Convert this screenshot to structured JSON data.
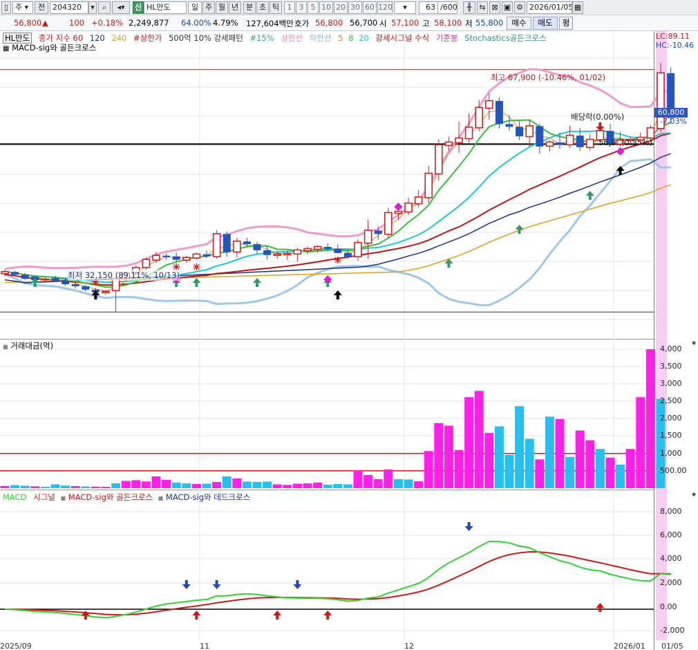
{
  "toolbar": {
    "type_select": "주",
    "prev_label": "전",
    "code_value": "204320",
    "badge": "신",
    "stock_name": "HL만도",
    "periods": [
      "일",
      "주",
      "월",
      "년",
      "분",
      "초",
      "틱"
    ],
    "active_period": "일",
    "intervals": [
      "1",
      "3",
      "5",
      "10",
      "20",
      "30",
      "60",
      "120"
    ],
    "page_count": "63",
    "page_total": "/600",
    "date_value": "2026/01/05"
  },
  "quote": {
    "price": "56,800",
    "change_arrow": "▲",
    "change": "100",
    "change_pct": "+0.18%",
    "volume": "2,249,877",
    "ratio1": "64.00%",
    "ratio2": "4.79%",
    "amount": "127,604백만",
    "ask_label": "호가",
    "ask1": "56,800",
    "ask2": "56,700",
    "open_label": "시",
    "open": "57,100",
    "high_label": "고",
    "high": "58,100",
    "low_label": "저",
    "low": "55,800",
    "buy_label": "매수",
    "sell_label": "매도",
    "eval_label": "평"
  },
  "price_panel": {
    "legend": [
      "HL만도",
      "종가 지수 60",
      "120",
      "240",
      "#상한가",
      "500억 10% 강세패턴",
      "#15%",
      "상한선",
      "하한선",
      "5",
      "8",
      "20",
      "강세시그널 수식",
      "기준봉",
      "Stochastics골든크로스"
    ],
    "legend2": "MACD-sig와 골든크로스",
    "lc": "LC:89.11",
    "hc": "HC:-10.46",
    "high_note": "최고 67,900 (-10.46%, 01/02)",
    "low_note": "최저 32,150 (89.11%, 10/13)",
    "dividend_note": "배당락(0.00%)",
    "level_note": "56,9..(0.35%)",
    "current_price": "60,800",
    "current_pct": "-7.03%"
  },
  "volume_panel": {
    "title": "거래대금(억)",
    "ticks": [
      "4,000",
      "3,500",
      "3,000",
      "2,500",
      "2,000",
      "1,500",
      "1,000",
      "500.00"
    ]
  },
  "macd_panel": {
    "legend": [
      "MACD",
      "시그널",
      "MACD-sig와 골든크로스",
      "MACD-sig와 데드크로스"
    ],
    "ticks": [
      "8,000",
      "6,000",
      "4,000",
      "2,000",
      "0.00",
      "-2,000"
    ]
  },
  "xaxis": {
    "labels": [
      "2025/09",
      "11",
      "12",
      "2026/01",
      "01/05"
    ]
  },
  "colors": {
    "up": "#d81f1f",
    "down": "#1f56c4",
    "vol_up": "#ff1fe8",
    "vol_down": "#23c0f0",
    "highlight": "#f8c6f2"
  },
  "chart_data": {
    "type": "candlestick",
    "candles": [
      {
        "o": 37800,
        "h": 38400,
        "l": 37400,
        "c": 38100
      },
      {
        "o": 38000,
        "h": 38200,
        "l": 37500,
        "c": 37700
      },
      {
        "o": 37600,
        "h": 37900,
        "l": 36900,
        "c": 37100
      },
      {
        "o": 37300,
        "h": 37600,
        "l": 36700,
        "c": 36900
      },
      {
        "o": 36900,
        "h": 37300,
        "l": 36500,
        "c": 37000
      },
      {
        "o": 37100,
        "h": 37500,
        "l": 36600,
        "c": 36800
      },
      {
        "o": 36800,
        "h": 37200,
        "l": 36000,
        "c": 36300
      },
      {
        "o": 36200,
        "h": 36600,
        "l": 35600,
        "c": 36000
      },
      {
        "o": 35900,
        "h": 36100,
        "l": 35200,
        "c": 35500
      },
      {
        "o": 35400,
        "h": 35700,
        "l": 34800,
        "c": 35100
      },
      {
        "o": 35000,
        "h": 35300,
        "l": 34700,
        "c": 35200
      },
      {
        "o": 35300,
        "h": 37400,
        "l": 32150,
        "c": 37100
      },
      {
        "o": 37100,
        "h": 38000,
        "l": 36700,
        "c": 37900
      },
      {
        "o": 37900,
        "h": 39000,
        "l": 37500,
        "c": 38700
      },
      {
        "o": 38700,
        "h": 40200,
        "l": 38300,
        "c": 39900
      },
      {
        "o": 39800,
        "h": 41000,
        "l": 39300,
        "c": 40500
      },
      {
        "o": 40400,
        "h": 40800,
        "l": 39800,
        "c": 40300
      },
      {
        "o": 40300,
        "h": 40900,
        "l": 39600,
        "c": 39900
      },
      {
        "o": 39800,
        "h": 40400,
        "l": 39400,
        "c": 40200
      },
      {
        "o": 40100,
        "h": 40900,
        "l": 39900,
        "c": 40700
      },
      {
        "o": 40600,
        "h": 41200,
        "l": 40100,
        "c": 40400
      },
      {
        "o": 40300,
        "h": 44200,
        "l": 40000,
        "c": 43700
      },
      {
        "o": 43600,
        "h": 44000,
        "l": 40300,
        "c": 41000
      },
      {
        "o": 41000,
        "h": 43100,
        "l": 40200,
        "c": 42600
      },
      {
        "o": 42500,
        "h": 43100,
        "l": 41700,
        "c": 42200
      },
      {
        "o": 42100,
        "h": 42500,
        "l": 40700,
        "c": 41300
      },
      {
        "o": 41200,
        "h": 41900,
        "l": 39900,
        "c": 40600
      },
      {
        "o": 40500,
        "h": 41100,
        "l": 40000,
        "c": 40700
      },
      {
        "o": 40600,
        "h": 41200,
        "l": 39800,
        "c": 40800
      },
      {
        "o": 40700,
        "h": 41600,
        "l": 39600,
        "c": 41300
      },
      {
        "o": 41200,
        "h": 41800,
        "l": 40600,
        "c": 41500
      },
      {
        "o": 41400,
        "h": 42000,
        "l": 40900,
        "c": 41800
      },
      {
        "o": 41700,
        "h": 42300,
        "l": 41100,
        "c": 41500
      },
      {
        "o": 41400,
        "h": 42100,
        "l": 40800,
        "c": 40900
      },
      {
        "o": 40800,
        "h": 41300,
        "l": 40000,
        "c": 40300
      },
      {
        "o": 40300,
        "h": 42900,
        "l": 39700,
        "c": 42400
      },
      {
        "o": 42300,
        "h": 45800,
        "l": 40000,
        "c": 44200
      },
      {
        "o": 44100,
        "h": 44800,
        "l": 42800,
        "c": 43700
      },
      {
        "o": 43600,
        "h": 47500,
        "l": 43100,
        "c": 46800
      },
      {
        "o": 46700,
        "h": 47800,
        "l": 45700,
        "c": 47000
      },
      {
        "o": 46900,
        "h": 49000,
        "l": 46400,
        "c": 48200
      },
      {
        "o": 48100,
        "h": 50100,
        "l": 47600,
        "c": 49100
      },
      {
        "o": 49000,
        "h": 53700,
        "l": 48200,
        "c": 52600
      },
      {
        "o": 52500,
        "h": 57600,
        "l": 51500,
        "c": 56800
      },
      {
        "o": 56700,
        "h": 58000,
        "l": 55900,
        "c": 57200
      },
      {
        "o": 57100,
        "h": 60200,
        "l": 55600,
        "c": 57800
      },
      {
        "o": 57700,
        "h": 61400,
        "l": 57100,
        "c": 59400
      },
      {
        "o": 59300,
        "h": 63400,
        "l": 58800,
        "c": 62300
      },
      {
        "o": 62200,
        "h": 64400,
        "l": 60500,
        "c": 63300
      },
      {
        "o": 63200,
        "h": 63800,
        "l": 59200,
        "c": 59900
      },
      {
        "o": 59800,
        "h": 61200,
        "l": 58900,
        "c": 59500
      },
      {
        "o": 59400,
        "h": 60300,
        "l": 57500,
        "c": 58100
      },
      {
        "o": 58000,
        "h": 60500,
        "l": 56500,
        "c": 59600
      },
      {
        "o": 59500,
        "h": 59900,
        "l": 55500,
        "c": 56600
      },
      {
        "o": 56600,
        "h": 57500,
        "l": 55800,
        "c": 57200
      },
      {
        "o": 57100,
        "h": 58600,
        "l": 56200,
        "c": 56900
      },
      {
        "o": 56800,
        "h": 59600,
        "l": 56300,
        "c": 58200
      },
      {
        "o": 58100,
        "h": 59300,
        "l": 55900,
        "c": 56500
      },
      {
        "o": 56400,
        "h": 58400,
        "l": 56000,
        "c": 57600
      },
      {
        "o": 57500,
        "h": 59600,
        "l": 57100,
        "c": 58900
      },
      {
        "o": 58800,
        "h": 59900,
        "l": 56500,
        "c": 57000
      },
      {
        "o": 56900,
        "h": 58700,
        "l": 56500,
        "c": 57500
      },
      {
        "o": 57400,
        "h": 58000,
        "l": 57000,
        "c": 57600
      },
      {
        "o": 57500,
        "h": 58600,
        "l": 57000,
        "c": 57900
      },
      {
        "o": 57800,
        "h": 59700,
        "l": 57200,
        "c": 59300
      },
      {
        "o": 59200,
        "h": 68900,
        "l": 58700,
        "c": 67400
      },
      {
        "o": 67300,
        "h": 68200,
        "l": 60000,
        "c": 60800
      }
    ],
    "volume": [
      {
        "v": 65,
        "up": true
      },
      {
        "v": 90,
        "up": false
      },
      {
        "v": 70,
        "up": false
      },
      {
        "v": 55,
        "up": true
      },
      {
        "v": 40,
        "up": false
      },
      {
        "v": 110,
        "up": false
      },
      {
        "v": 75,
        "up": false
      },
      {
        "v": 60,
        "up": true
      },
      {
        "v": 50,
        "up": false
      },
      {
        "v": 45,
        "up": true
      },
      {
        "v": 40,
        "up": true
      },
      {
        "v": 140,
        "up": false
      },
      {
        "v": 210,
        "up": true
      },
      {
        "v": 230,
        "up": true
      },
      {
        "v": 195,
        "up": true
      },
      {
        "v": 340,
        "up": true
      },
      {
        "v": 240,
        "up": true
      },
      {
        "v": 160,
        "up": false
      },
      {
        "v": 140,
        "up": false
      },
      {
        "v": 120,
        "up": true
      },
      {
        "v": 130,
        "up": false
      },
      {
        "v": 180,
        "up": true
      },
      {
        "v": 340,
        "up": false
      },
      {
        "v": 280,
        "up": true
      },
      {
        "v": 190,
        "up": false
      },
      {
        "v": 180,
        "up": false
      },
      {
        "v": 190,
        "up": false
      },
      {
        "v": 110,
        "up": true
      },
      {
        "v": 95,
        "up": true
      },
      {
        "v": 130,
        "up": true
      },
      {
        "v": 140,
        "up": true
      },
      {
        "v": 160,
        "up": true
      },
      {
        "v": 100,
        "up": false
      },
      {
        "v": 120,
        "up": false
      },
      {
        "v": 110,
        "up": false
      },
      {
        "v": 510,
        "up": true
      },
      {
        "v": 380,
        "up": true
      },
      {
        "v": 260,
        "up": true
      },
      {
        "v": 540,
        "up": true
      },
      {
        "v": 260,
        "up": false
      },
      {
        "v": 250,
        "up": false
      },
      {
        "v": 200,
        "up": true
      },
      {
        "v": 1070,
        "up": true
      },
      {
        "v": 1870,
        "up": true
      },
      {
        "v": 1800,
        "up": true
      },
      {
        "v": 1100,
        "up": true
      },
      {
        "v": 2620,
        "up": true
      },
      {
        "v": 2800,
        "up": true
      },
      {
        "v": 1590,
        "up": true
      },
      {
        "v": 1780,
        "up": false
      },
      {
        "v": 960,
        "up": false
      },
      {
        "v": 2360,
        "up": false
      },
      {
        "v": 1420,
        "up": false
      },
      {
        "v": 830,
        "up": true
      },
      {
        "v": 2060,
        "up": false
      },
      {
        "v": 1990,
        "up": true
      },
      {
        "v": 900,
        "up": false
      },
      {
        "v": 1660,
        "up": true
      },
      {
        "v": 1380,
        "up": true
      },
      {
        "v": 1130,
        "up": false
      },
      {
        "v": 880,
        "up": true
      },
      {
        "v": 680,
        "up": false
      },
      {
        "v": 1130,
        "up": true
      },
      {
        "v": 2620,
        "up": true
      },
      {
        "v": 4000,
        "up": true
      },
      {
        "v": 2570,
        "up": false
      }
    ],
    "price_ylim": [
      28400,
      70800
    ],
    "high_level": 67900,
    "low_level": 32150,
    "ref_level": 56900,
    "volume_ylim": [
      0,
      4000
    ],
    "volume_ref_levels": [
      1000,
      500
    ],
    "macd_ylim": [
      -2500,
      8500
    ]
  }
}
